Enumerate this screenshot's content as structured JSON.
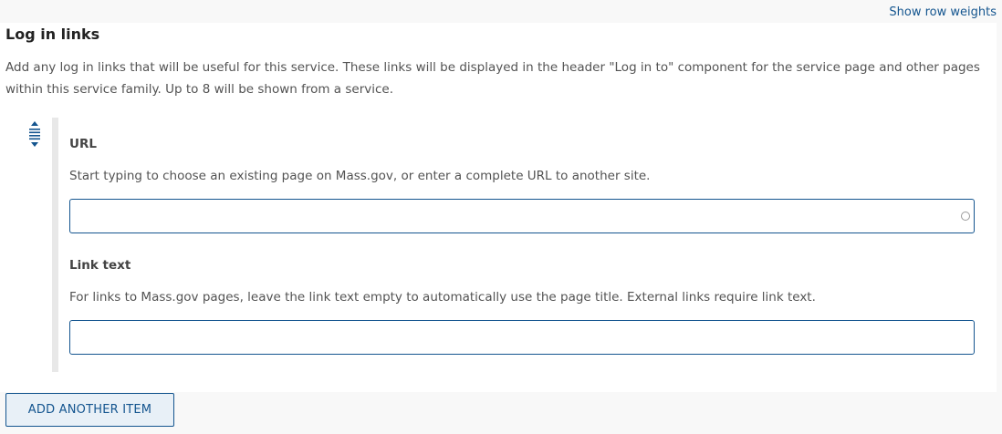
{
  "header": {
    "show_row_weights": "Show row weights"
  },
  "section": {
    "title": "Log in links",
    "description": "Add any log in links that will be useful for this service. These links will be displayed in the header \"Log in to\" component for the service page and other pages within this service family. Up to 8 will be shown from a service."
  },
  "item": {
    "url_label": "URL",
    "url_description": "Start typing to choose an existing page on Mass.gov, or enter a complete URL to another site.",
    "url_value": "",
    "link_text_label": "Link text",
    "link_text_description": "For links to Mass.gov pages, leave the link text empty to automatically use the page title. External links require link text.",
    "link_text_value": ""
  },
  "actions": {
    "add_another_item": "ADD ANOTHER ITEM"
  },
  "colors": {
    "accent": "#14558f",
    "background": "#f8f8f8",
    "panel": "#ffffff"
  },
  "icons": {
    "drag_handle": "drag-handle-icon",
    "throbber": "autocomplete-throbber-icon"
  }
}
